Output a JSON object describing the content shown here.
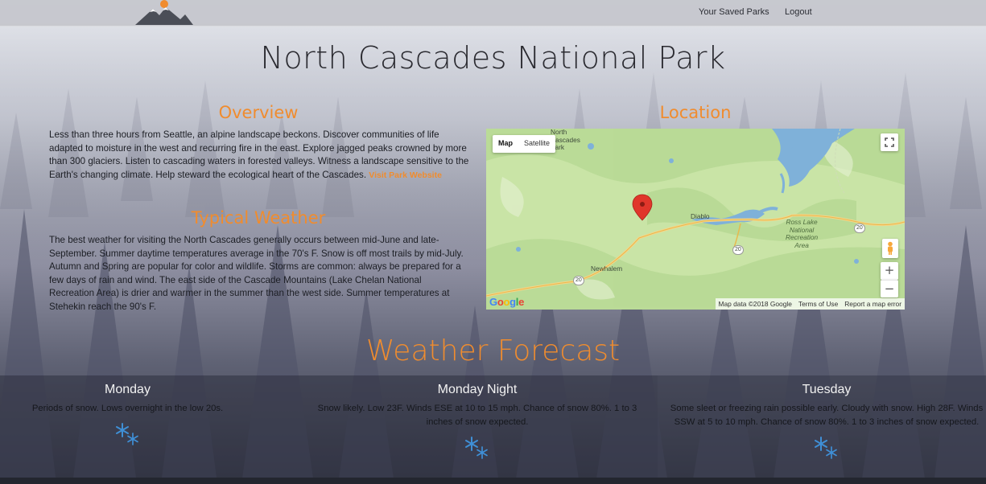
{
  "nav": {
    "saved_parks": "Your Saved Parks",
    "logout": "Logout"
  },
  "page": {
    "title": "North Cascades National Park"
  },
  "overview": {
    "heading": "Overview",
    "text": "Less than three hours from Seattle, an alpine landscape beckons. Discover communities of life adapted to moisture in the west and recurring fire in the east. Explore jagged peaks crowned by more than 300 glaciers. Listen to cascading waters in forested valleys. Witness a landscape sensitive to the Earth's changing climate. Help steward the ecological heart of the Cascades.",
    "link_label": "Visit Park Website"
  },
  "typical_weather": {
    "heading": "Typical Weather",
    "text": "The best weather for visiting the North Cascades generally occurs between mid-June and late-September. Summer daytime temperatures average in the 70's F. Snow is off most trails by mid-July. Autumn and Spring are popular for color and wildlife. Storms are common: always be prepared for a few days of rain and wind. The east side of the Cascade Mountains (Lake Chelan National Recreation Area) is drier and warmer in the summer than the west side. Summer temperatures at Stehekin reach the 90's F."
  },
  "location": {
    "heading": "Location",
    "map": {
      "type_map": "Map",
      "type_satellite": "Satellite",
      "labels": {
        "north_cascades_1": "North",
        "north_cascades_2": "Cascades",
        "north_cascades_3": "Park",
        "diablo": "Diablo",
        "ross_lake_1": "Ross Lake",
        "ross_lake_2": "National",
        "ross_lake_3": "Recreation",
        "ross_lake_4": "Area",
        "newhalem": "Newhalem",
        "route_20a": "20",
        "route_20b": "20",
        "route_20c": "20"
      },
      "zoom_in": "+",
      "zoom_out": "−",
      "attribution": "Map data ©2018 Google",
      "terms": "Terms of Use",
      "report": "Report a map error",
      "google_letters": [
        "G",
        "o",
        "o",
        "g",
        "l",
        "e"
      ],
      "google_colors": [
        "#4285f4",
        "#ea4335",
        "#fbbc05",
        "#4285f4",
        "#34a853",
        "#ea4335"
      ]
    }
  },
  "forecast": {
    "heading": "Weather Forecast",
    "days": [
      {
        "name": "Monday",
        "description": "Periods of snow. Lows overnight in the low 20s.",
        "icon": "snow-icon"
      },
      {
        "name": "Monday Night",
        "description": "Snow likely. Low 23F. Winds ESE at 10 to 15 mph. Chance of snow 80%. 1 to 3 inches of snow expected.",
        "icon": "snow-icon"
      },
      {
        "name": "Tuesday",
        "description": "Some sleet or freezing rain possible early. Cloudy with snow. High 28F. Winds SSW at 5 to 10 mph. Chance of snow 80%. 1 to 3 inches of snow expected.",
        "icon": "snow-icon"
      }
    ]
  },
  "colors": {
    "accent": "#f08c2e",
    "map_land": "#c6e2a4",
    "map_water": "#7fb1d9",
    "snow_icon": "#3f8fd6"
  }
}
